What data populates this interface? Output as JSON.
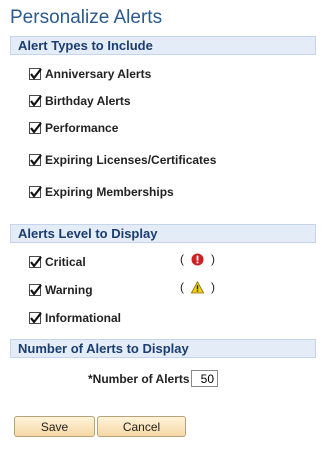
{
  "page": {
    "title": "Personalize Alerts"
  },
  "sections": {
    "alert_types": {
      "title": "Alert Types to Include"
    },
    "alert_level": {
      "title": "Alerts Level to Display"
    },
    "alert_count": {
      "title": "Number of Alerts to Display"
    }
  },
  "alert_types": [
    {
      "label": "Anniversary Alerts",
      "checked": true
    },
    {
      "label": "Birthday Alerts",
      "checked": true
    },
    {
      "label": "Performance",
      "checked": true
    },
    {
      "label": "Expiring Licenses/Certificates",
      "checked": true
    },
    {
      "label": "Expiring Memberships",
      "checked": true
    }
  ],
  "alert_levels": [
    {
      "label": "Critical",
      "checked": true,
      "icon": "critical-icon",
      "paren_open": "(",
      "paren_close": ")"
    },
    {
      "label": "Warning",
      "checked": true,
      "icon": "warning-icon",
      "paren_open": "(",
      "paren_close": ")"
    },
    {
      "label": "Informational",
      "checked": true
    }
  ],
  "number_of_alerts": {
    "label": "*Number of Alerts",
    "value": "50"
  },
  "buttons": {
    "save": "Save",
    "cancel": "Cancel"
  },
  "colors": {
    "title": "#2a5a8f",
    "section_bg": "#e4ecf7",
    "section_text": "#1c3d70",
    "button_bg": "#f5d8a4",
    "critical": "#cc2222",
    "warning": "#f2cf1f"
  }
}
